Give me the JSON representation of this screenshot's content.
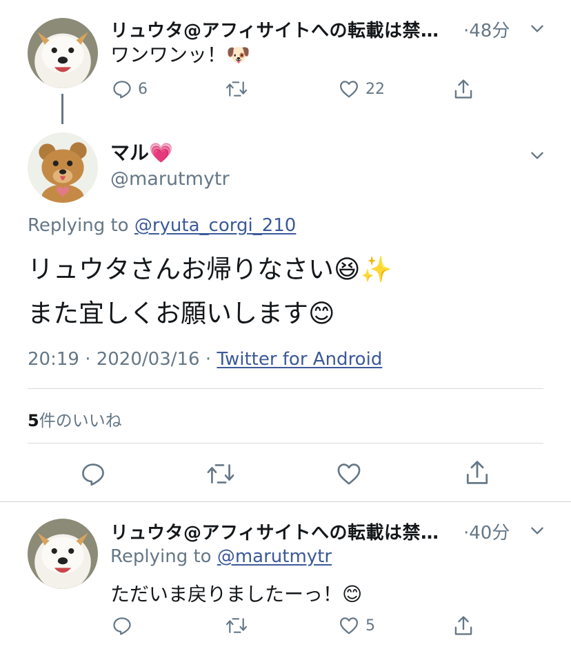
{
  "tweet1": {
    "author": "リュウタ@アフィサイトへの転載は禁…",
    "time": "·48分",
    "text": "ワンワンッ！🐶",
    "reply_count": "6",
    "retweet_count": "",
    "like_count": "22"
  },
  "main": {
    "display_name": "マル💗",
    "handle": "@marutmytr",
    "replying_prefix": "Replying to ",
    "replying_to": "@ryuta_corgi_210",
    "text_line1": "リュウタさんお帰りなさい😆✨",
    "text_line2": "また宜しくお願いします😊",
    "timestamp": "20:19 · 2020/03/16 · ",
    "source": "Twitter for Android",
    "likes_number": "5",
    "likes_suffix": "件のいいね"
  },
  "tweet3": {
    "author": "リュウタ@アフィサイトへの転載は禁…",
    "time": "·40分",
    "replying_prefix": "Replying to ",
    "replying_to": "@marutmytr",
    "text": "ただいま戻りましたーっ！😊",
    "reply_count": "",
    "retweet_count": "",
    "like_count": "5"
  },
  "icons": [
    "reply-icon",
    "retweet-icon",
    "like-icon",
    "share-icon",
    "chevron-down-icon"
  ],
  "colors": {
    "link": "#3b5998",
    "muted": "#657786",
    "divider": "#d6dadd"
  }
}
